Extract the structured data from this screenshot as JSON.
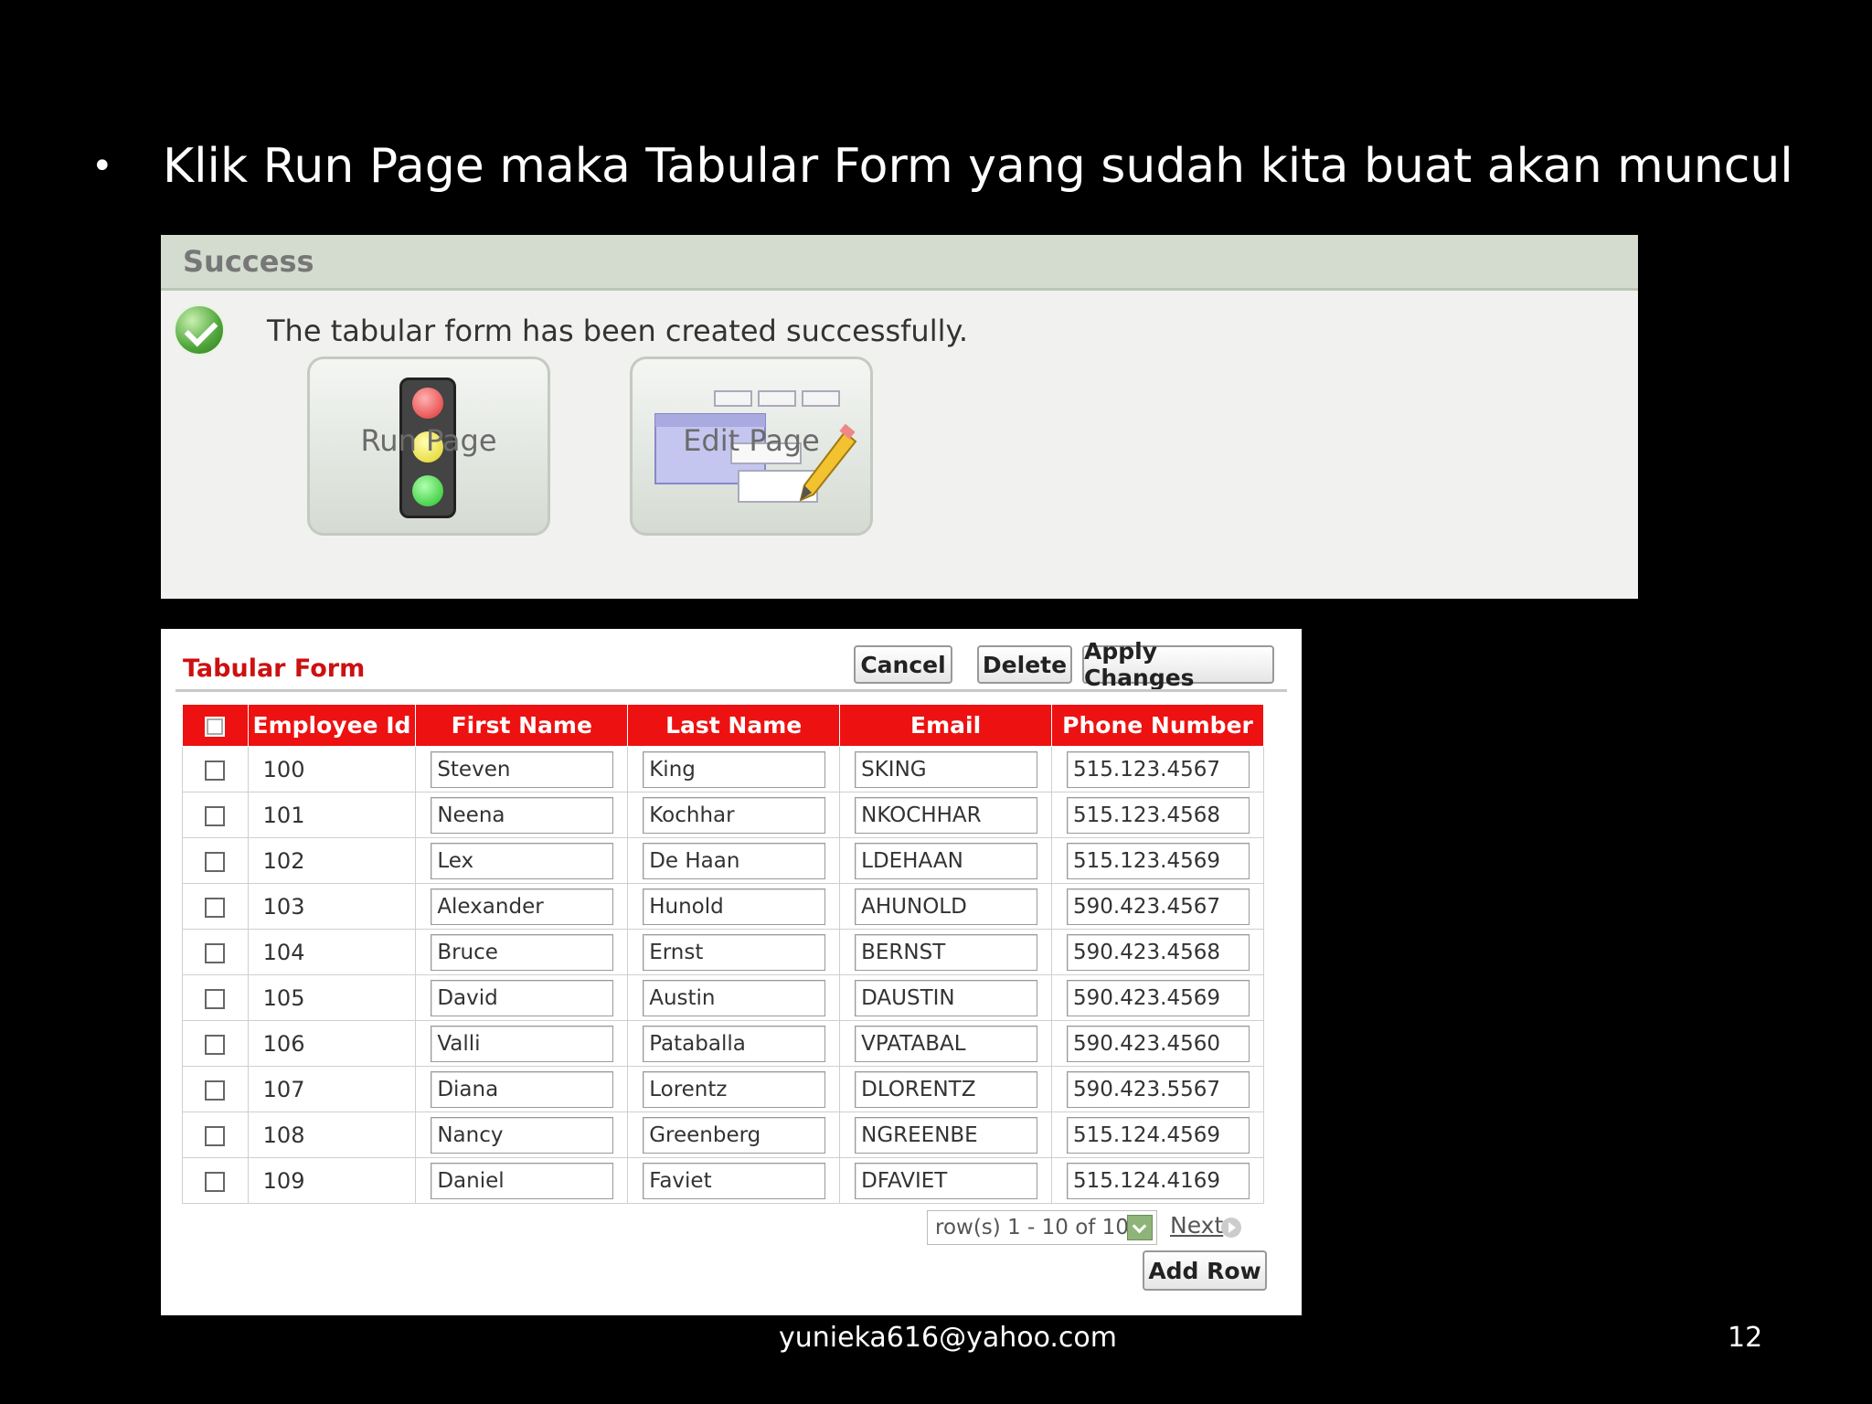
{
  "slide": {
    "bullet": "•",
    "heading": "Klik Run Page maka Tabular Form yang sudah kita buat akan muncul",
    "footer_email": "yunieka616@yahoo.com",
    "page_number": "12"
  },
  "success_panel": {
    "title": "Success",
    "message": "The tabular form has been created successfully.",
    "run_page_label": "Run Page",
    "edit_page_label": "Edit Page"
  },
  "tabular_form": {
    "title": "Tabular Form",
    "buttons": {
      "cancel": "Cancel",
      "delete": "Delete",
      "apply": "Apply Changes",
      "add_row": "Add Row"
    },
    "columns": [
      "Employee Id",
      "First Name",
      "Last Name",
      "Email",
      "Phone Number"
    ],
    "rows": [
      {
        "id": "100",
        "first": "Steven",
        "last": "King",
        "email": "SKING",
        "phone": "515.123.4567"
      },
      {
        "id": "101",
        "first": "Neena",
        "last": "Kochhar",
        "email": "NKOCHHAR",
        "phone": "515.123.4568"
      },
      {
        "id": "102",
        "first": "Lex",
        "last": "De Haan",
        "email": "LDEHAAN",
        "phone": "515.123.4569"
      },
      {
        "id": "103",
        "first": "Alexander",
        "last": "Hunold",
        "email": "AHUNOLD",
        "phone": "590.423.4567"
      },
      {
        "id": "104",
        "first": "Bruce",
        "last": "Ernst",
        "email": "BERNST",
        "phone": "590.423.4568"
      },
      {
        "id": "105",
        "first": "David",
        "last": "Austin",
        "email": "DAUSTIN",
        "phone": "590.423.4569"
      },
      {
        "id": "106",
        "first": "Valli",
        "last": "Pataballa",
        "email": "VPATABAL",
        "phone": "590.423.4560"
      },
      {
        "id": "107",
        "first": "Diana",
        "last": "Lorentz",
        "email": "DLORENTZ",
        "phone": "590.423.5567"
      },
      {
        "id": "108",
        "first": "Nancy",
        "last": "Greenberg",
        "email": "NGREENBE",
        "phone": "515.124.4569"
      },
      {
        "id": "109",
        "first": "Daniel",
        "last": "Faviet",
        "email": "DFAVIET",
        "phone": "515.124.4169"
      }
    ],
    "pagination": {
      "range": "row(s) 1 - 10 of 107",
      "next_label": "Next"
    }
  },
  "colors": {
    "header_red": "#ee1111",
    "title_red": "#cc1111",
    "success_header": "#d3dccf"
  }
}
